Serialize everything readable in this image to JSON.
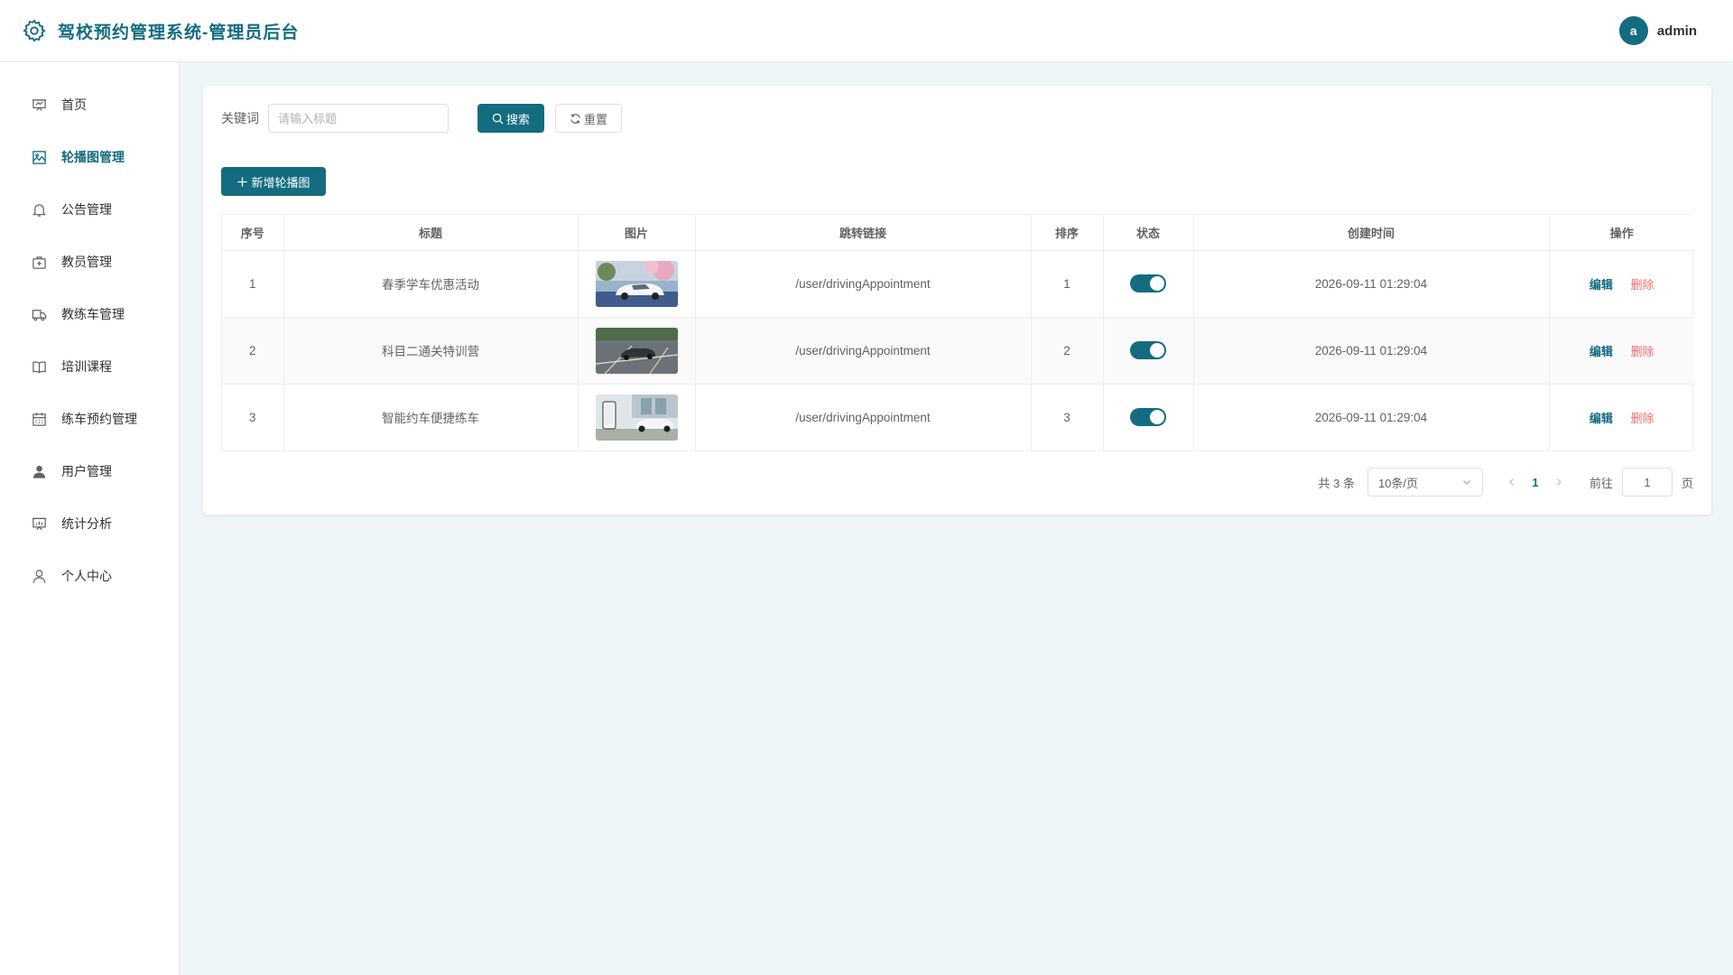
{
  "header": {
    "title": "驾校预约管理系统-管理员后台",
    "avatar_letter": "a",
    "username": "admin"
  },
  "sidebar": {
    "items": [
      {
        "label": "首页",
        "icon": "presentation-icon"
      },
      {
        "label": "轮播图管理",
        "icon": "picture-icon",
        "active": true
      },
      {
        "label": "公告管理",
        "icon": "bell-icon"
      },
      {
        "label": "教员管理",
        "icon": "first-aid-kit-icon"
      },
      {
        "label": "教练车管理",
        "icon": "van-icon"
      },
      {
        "label": "培训课程",
        "icon": "book-icon"
      },
      {
        "label": "练车预约管理",
        "icon": "calendar-icon"
      },
      {
        "label": "用户管理",
        "icon": "user-solid-icon"
      },
      {
        "label": "统计分析",
        "icon": "data-board-icon"
      },
      {
        "label": "个人中心",
        "icon": "user-icon"
      }
    ]
  },
  "search": {
    "label": "关键词",
    "placeholder": "请输入标题",
    "value": "",
    "search_label": "搜索",
    "reset_label": "重置"
  },
  "toolbar": {
    "add_label": "新增轮播图"
  },
  "table": {
    "columns": [
      "序号",
      "标题",
      "图片",
      "跳转链接",
      "排序",
      "状态",
      "创建时间",
      "操作"
    ],
    "rows": [
      {
        "index": "1",
        "title": "春季学车优惠活动",
        "image": "white-car-cherry-blossoms",
        "link": "/user/drivingAppointment",
        "sort": "1",
        "status": true,
        "created": "2026-09-11 01:29:04"
      },
      {
        "index": "2",
        "title": "科目二通关特训营",
        "image": "car-on-training-ground",
        "link": "/user/drivingAppointment",
        "sort": "2",
        "status": true,
        "created": "2026-09-11 01:29:04"
      },
      {
        "index": "3",
        "title": "智能约车便捷练车",
        "image": "phone-app-with-white-car",
        "link": "/user/drivingAppointment",
        "sort": "3",
        "status": true,
        "created": "2026-09-11 01:29:04"
      }
    ],
    "edit_label": "编辑",
    "delete_label": "删除"
  },
  "pagination": {
    "total_text": "共 3 条",
    "page_size": "10条/页",
    "current_page": "1",
    "goto_label": "前往",
    "goto_value": "1",
    "page_suffix": "页"
  },
  "colors": {
    "primary": "#136c80",
    "danger": "#f56c6c",
    "background": "#eff6f7"
  }
}
